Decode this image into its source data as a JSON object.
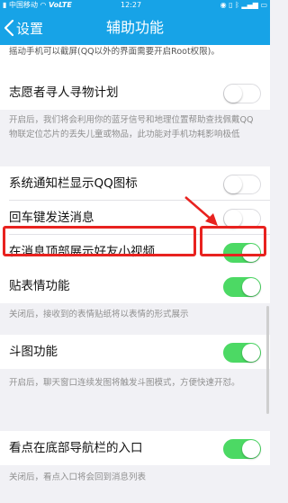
{
  "status_bar": {
    "carrier": "中国移动",
    "network": "VoLTE",
    "time": "12:27",
    "battery": "battery-icon",
    "signal": "signal-icon",
    "wifi": "wifi-icon"
  },
  "nav": {
    "back_label": "设置",
    "title": "辅助功能"
  },
  "top_desc": "摇动手机可以截屏(QQ以外的界面需要开启Root权限)。",
  "settings": [
    {
      "label": "志愿者寻人寻物计划",
      "state": "off",
      "desc": "开启后，我们将会利用你的蓝牙信号和地理位置帮助查找佩戴QQ物联定位芯片的丢失儿童或物品，此功能对手机功耗影响极低"
    },
    {
      "label": "系统通知栏显示QQ图标",
      "state": "off"
    },
    {
      "label": "回车键发送消息",
      "state": "off"
    },
    {
      "label": "在消息顶部展示好友小视频",
      "state": "on",
      "highlighted": true
    },
    {
      "label": "贴表情功能",
      "state": "on",
      "desc": "关闭后，接收到的表情贴纸将以表情的形式展示"
    },
    {
      "label": "斗图功能",
      "state": "on",
      "desc": "开启后，聊天窗口连续发图将触发斗图模式，方便快速开怼。"
    },
    {
      "label": "看点在底部导航栏的入口",
      "state": "on",
      "desc": "关闭后，看点入口将会回到消息列表"
    }
  ],
  "colors": {
    "brand": "#17a3e7",
    "toggle_on": "#4cd964",
    "annotation": "#e8221f"
  }
}
